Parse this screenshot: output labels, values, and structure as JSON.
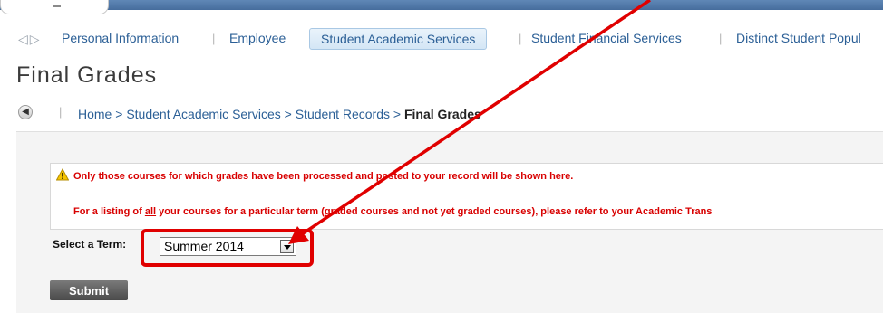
{
  "nav": {
    "tabs": [
      {
        "label": "Personal Information"
      },
      {
        "label": "Employee"
      },
      {
        "label": "Student Academic Services",
        "active": true
      },
      {
        "label": "Student Financial Services"
      },
      {
        "label": "Distinct Student Popul"
      }
    ]
  },
  "page": {
    "title": "Final Grades"
  },
  "breadcrumb": {
    "home": "Home",
    "level1": "Student Academic Services",
    "level2": "Student Records",
    "current": "Final Grades",
    "separator": ">"
  },
  "notice": {
    "line1": "Only those courses for which grades have been processed and posted to your record will be shown here.",
    "line2_before": "For a listing of ",
    "line2_emphasis": "all",
    "line2_after": " your courses for a particular term (graded courses and not yet graded courses), please refer to your Academic Trans"
  },
  "term": {
    "label": "Select a Term:",
    "selected": "Summer 2014"
  },
  "submit": {
    "label": "Submit"
  },
  "colors": {
    "banner": "#466d9d",
    "link": "#2b5f96",
    "notice_text": "#d80000",
    "annotation": "#e00000"
  }
}
